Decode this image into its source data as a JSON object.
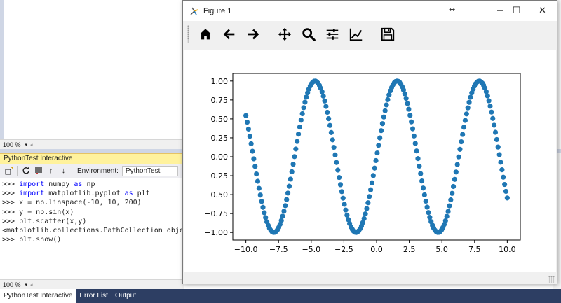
{
  "ide": {
    "zoom_top": "100 %",
    "zoom_bottom": "100 %",
    "panel_title": "PythonTest Interactive",
    "environment_label": "Environment:",
    "environment_value": "PythonTest",
    "console_lines": [
      [
        {
          "t": ">>> "
        },
        {
          "t": "import",
          "k": 1
        },
        {
          "t": " numpy "
        },
        {
          "t": "as",
          "k": 1
        },
        {
          "t": " np"
        }
      ],
      [
        {
          "t": ">>> "
        },
        {
          "t": "import",
          "k": 1
        },
        {
          "t": " matplotlib.pyplot "
        },
        {
          "t": "as",
          "k": 1
        },
        {
          "t": " plt"
        }
      ],
      [
        {
          "t": ">>> x = np.linspace(-10, 10, 200)"
        }
      ],
      [
        {
          "t": ">>> y = np.sin(x)"
        }
      ],
      [
        {
          "t": ">>> plt.scatter(x,y)"
        }
      ],
      [
        {
          "t": "<matplotlib.collections.PathCollection obje"
        }
      ],
      [
        {
          "t": ">>> plt.show()"
        }
      ]
    ],
    "bottom_tabs": [
      "PythonTest Interactive",
      "Error List",
      "Output"
    ],
    "active_tab": 0
  },
  "figure_window": {
    "title": "Figure 1",
    "resize_glyph": "↔",
    "minimize_glyph": "—",
    "maximize_glyph": "☐",
    "close_glyph": "✕",
    "toolbar_icons": [
      [
        "home-icon",
        "back-arrow-icon",
        "forward-arrow-icon"
      ],
      [
        "pan-move-icon",
        "zoom-magnifier-icon",
        "subplots-config-icon",
        "edit-axis-icon"
      ],
      [
        "save-floppy-icon"
      ]
    ]
  },
  "chart_data": {
    "type": "scatter",
    "title": "",
    "xlabel": "",
    "ylabel": "",
    "x_range": [
      -10,
      10
    ],
    "n_points": 200,
    "y_function": "sin(x)",
    "xlim": [
      -11,
      11
    ],
    "ylim": [
      -1.1,
      1.1
    ],
    "x_ticks": [
      "−10.0",
      "−7.5",
      "−5.0",
      "−2.5",
      "0.0",
      "2.5",
      "5.0",
      "7.5",
      "10.0"
    ],
    "x_tick_values": [
      -10,
      -7.5,
      -5,
      -2.5,
      0,
      2.5,
      5,
      7.5,
      10
    ],
    "y_ticks": [
      "−1.00",
      "−0.75",
      "−0.50",
      "−0.25",
      "0.00",
      "0.25",
      "0.50",
      "0.75",
      "1.00"
    ],
    "y_tick_values": [
      -1,
      -0.75,
      -0.5,
      -0.25,
      0,
      0.25,
      0.5,
      0.75,
      1
    ],
    "marker_color": "#1f77b4",
    "grid": false,
    "legend": "none"
  }
}
